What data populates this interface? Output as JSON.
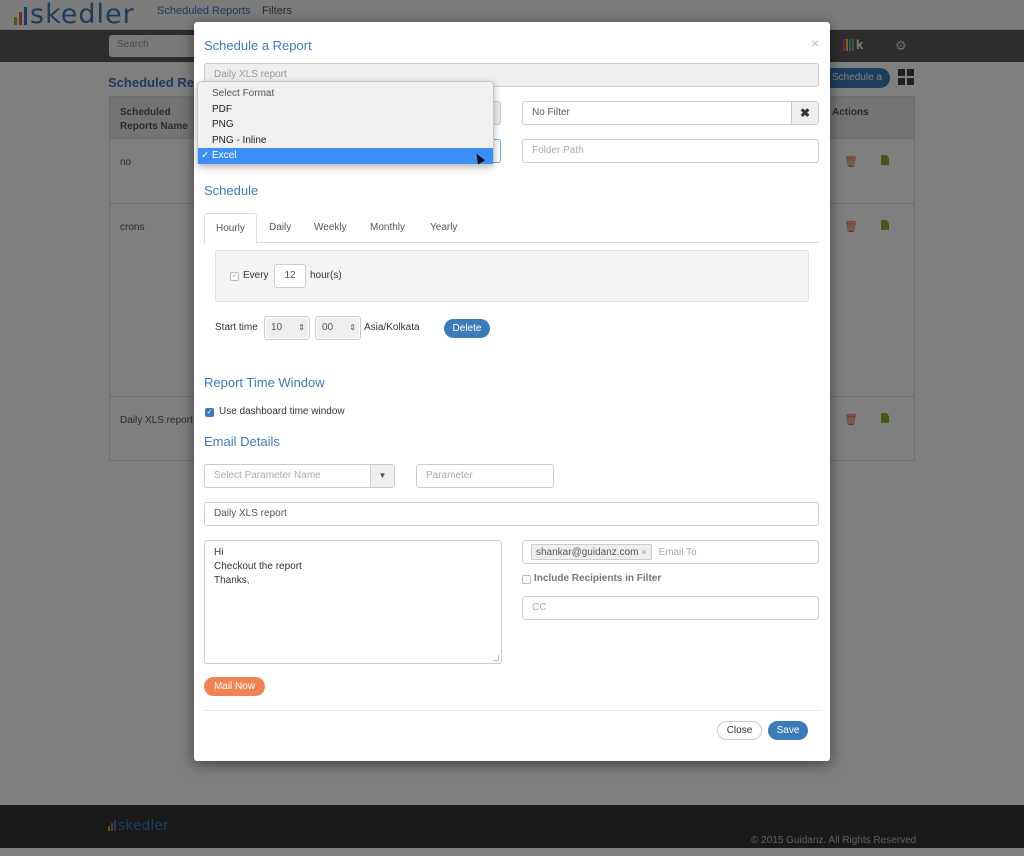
{
  "app": {
    "logo_text": "skedler",
    "nav": [
      "Scheduled Reports",
      "Filters"
    ],
    "search_placeholder": "Search",
    "kibana_letter": "k",
    "page_title": "Scheduled Reports",
    "schedule_button": "Schedule a Report",
    "colors": {
      "brand_blue": "#3d7ab8",
      "orange": "#ef8354",
      "green": "#8bb534",
      "red": "#e0653f"
    },
    "table": {
      "headers": [
        "Scheduled Reports Name",
        "Actions"
      ],
      "rows": [
        {
          "name": "no"
        },
        {
          "name": "crons"
        },
        {
          "name": "Daily XLS report"
        }
      ]
    },
    "footer": {
      "logo_text": "skedler",
      "copyright": "© 2015 Guidanz. All Rights Reserved"
    }
  },
  "modal": {
    "title": "Schedule a Report",
    "close_glyph": "×",
    "report_name": "Daily XLS report",
    "filter_value": "No Filter",
    "filter_clear_glyph": "✖",
    "folder_path_placeholder": "Folder Path",
    "format_dropdown": {
      "options": [
        "Select Format",
        "PDF",
        "PNG",
        "PNG - Inline",
        "Excel"
      ],
      "selected": "Excel",
      "check_glyph": "✓"
    },
    "schedule": {
      "title": "Schedule",
      "tabs": [
        "Hourly",
        "Daily",
        "Weekly",
        "Monthly",
        "Yearly"
      ],
      "active_tab": "Hourly",
      "every_label": "Every",
      "every_checked": true,
      "every_value": "12",
      "unit_label": "hour(s)",
      "start_time_label": "Start time",
      "start_hour": "10",
      "start_minute": "00",
      "timezone": "Asia/Kolkata",
      "delete_label": "Delete"
    },
    "time_window": {
      "title": "Report Time Window",
      "use_dashboard_label": "Use dashboard time window",
      "use_dashboard_checked": true
    },
    "email": {
      "title": "Email Details",
      "param_name_placeholder": "Select Parameter Name",
      "param_placeholder": "Parameter",
      "subject": "Daily XLS report",
      "body_lines": [
        "Hi",
        "Checkout the report",
        "Thanks,"
      ],
      "to_tags": [
        "shankar@guidanz.com"
      ],
      "to_placeholder": "Email To",
      "include_recipients_label": "Include Recipients in Filter",
      "include_recipients_checked": false,
      "cc_placeholder": "CC",
      "mail_now_label": "Mail Now"
    },
    "footer": {
      "close_label": "Close",
      "save_label": "Save"
    }
  }
}
